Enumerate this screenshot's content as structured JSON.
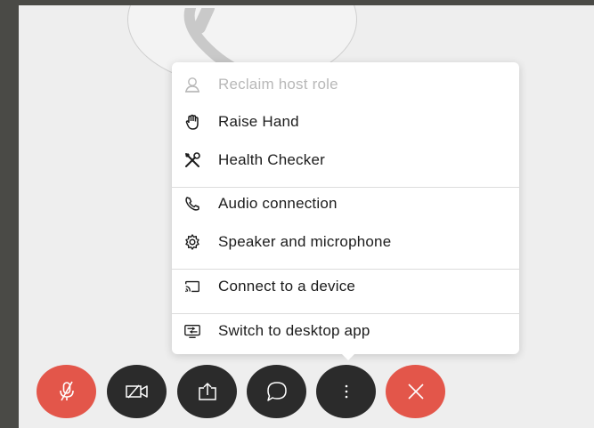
{
  "menu": {
    "items": [
      {
        "label": "Reclaim host role",
        "icon": "person-icon",
        "disabled": true
      },
      {
        "label": "Raise Hand",
        "icon": "hand-icon"
      },
      {
        "label": "Health Checker",
        "icon": "tools-icon"
      },
      {
        "label": "Audio connection",
        "icon": "phone-icon"
      },
      {
        "label": "Speaker and microphone",
        "icon": "gear-icon"
      },
      {
        "label": "Connect to a device",
        "icon": "cast-icon"
      },
      {
        "label": "Switch to desktop app",
        "icon": "desktop-app-icon"
      }
    ]
  },
  "controls": [
    {
      "name": "mute-button",
      "icon": "microphone-muted-icon",
      "color": "#e3564a"
    },
    {
      "name": "video-button",
      "icon": "video-off-icon",
      "color": "#2b2b2b"
    },
    {
      "name": "share-button",
      "icon": "share-icon",
      "color": "#2b2b2b"
    },
    {
      "name": "chat-button",
      "icon": "chat-icon",
      "color": "#2b2b2b"
    },
    {
      "name": "more-options-button",
      "icon": "more-icon",
      "color": "#2b2b2b"
    },
    {
      "name": "leave-button",
      "icon": "close-icon",
      "color": "#e3564a"
    }
  ],
  "colors": {
    "accent_red": "#e3564a",
    "dark_button": "#2b2b2b",
    "disabled_text": "#b8b8b8"
  }
}
